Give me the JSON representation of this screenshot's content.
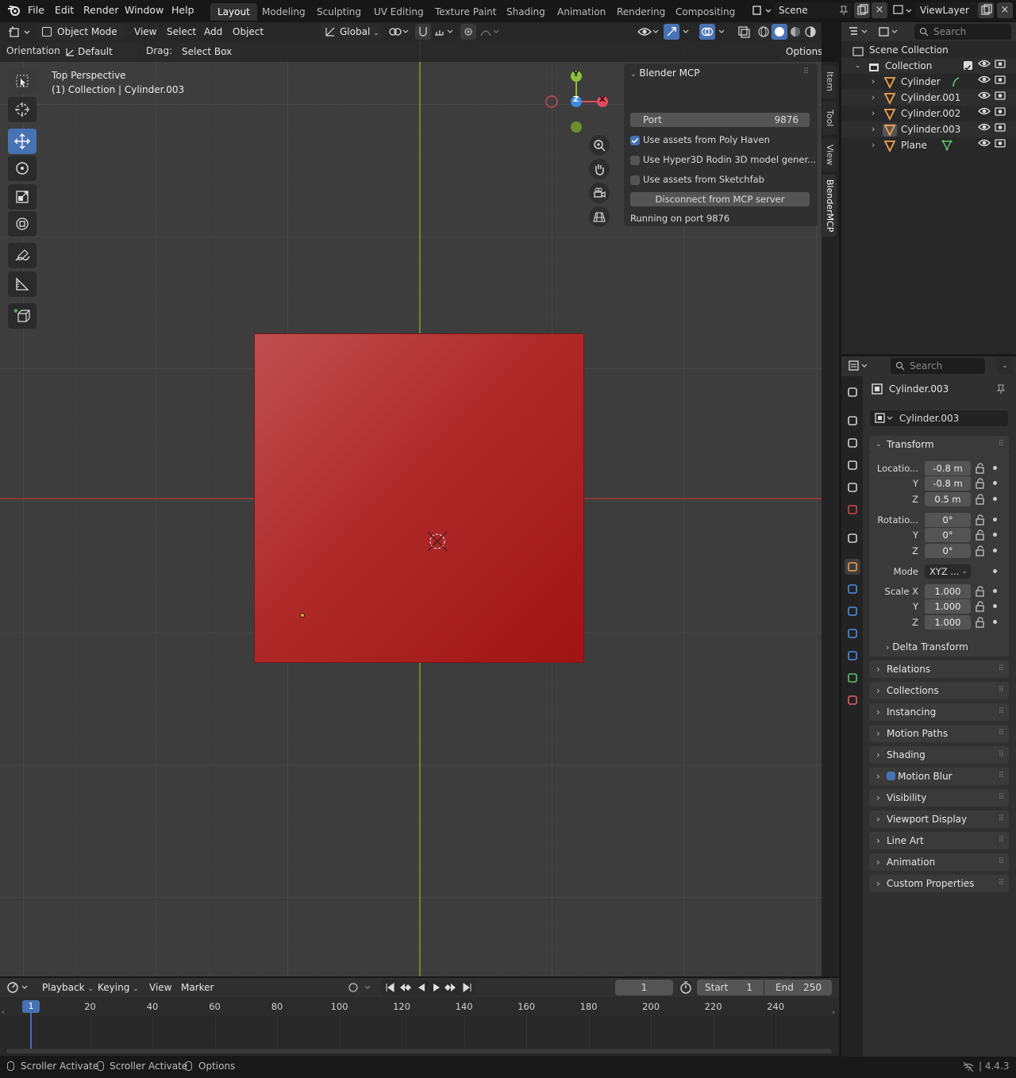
{
  "menu": {
    "items": [
      "File",
      "Edit",
      "Render",
      "Window",
      "Help"
    ]
  },
  "workspaces": [
    "Layout",
    "Modeling",
    "Sculpting",
    "UV Editing",
    "Texture Paint",
    "Shading",
    "Animation",
    "Rendering",
    "Compositing"
  ],
  "scene": {
    "name": "Scene",
    "view_layer": "ViewLayer"
  },
  "viewport_header": {
    "mode": "Object Mode",
    "menus": [
      "View",
      "Select",
      "Add",
      "Object"
    ],
    "transform_orientation": "Global"
  },
  "tool_header": {
    "orientation_label": "Orientation:",
    "orientation_value": "Default",
    "drag_label": "Drag:",
    "drag_value": "Select Box",
    "options": "Options"
  },
  "viewport": {
    "view_name": "Top Perspective",
    "context": "(1) Collection | Cylinder.003",
    "gizmo": {
      "x": "X",
      "y": "Y",
      "z": "Z"
    },
    "object_color": "#b22222"
  },
  "sidebar_tabs": [
    "Item",
    "Tool",
    "View",
    "BlenderMCP"
  ],
  "mcp_panel": {
    "title": "Blender MCP",
    "port_label": "Port",
    "port_value": "9876",
    "opt_polyhaven": "Use assets from Poly Haven",
    "opt_polyhaven_checked": true,
    "opt_hyper3d": "Use Hyper3D Rodin 3D model gener...",
    "opt_hyper3d_checked": false,
    "opt_sketchfab": "Use assets from Sketchfab",
    "opt_sketchfab_checked": false,
    "disconnect": "Disconnect from MCP server",
    "status": "Running on port 9876"
  },
  "outliner": {
    "search_placeholder": "Search",
    "scene_collection": "Scene Collection",
    "collection": "Collection",
    "items": [
      "Cylinder",
      "Cylinder.001",
      "Cylinder.002",
      "Cylinder.003",
      "Plane"
    ]
  },
  "properties": {
    "search_placeholder": "Search",
    "object_name": "Cylinder.003",
    "datablock": "Cylinder.003",
    "transform": {
      "title": "Transform",
      "location_label": "Locatio...",
      "loc_x": "-0.8 m",
      "loc_y": "-0.8 m",
      "loc_z": "0.5 m",
      "rotation_label": "Rotatio...",
      "rot_x": "0°",
      "rot_y": "0°",
      "rot_z": "0°",
      "mode_label": "Mode",
      "mode_value": "XYZ ...",
      "scale_label": "Scale X",
      "scale_x": "1.000",
      "scale_y": "1.000",
      "scale_z": "1.000",
      "y": "Y",
      "z": "Z",
      "delta": "Delta Transform"
    },
    "panels": [
      "Relations",
      "Collections",
      "Instancing",
      "Motion Paths",
      "Shading",
      "Motion Blur",
      "Visibility",
      "Viewport Display",
      "Line Art",
      "Animation",
      "Custom Properties"
    ]
  },
  "timeline": {
    "menus": [
      "Playback",
      "Keying",
      "View",
      "Marker"
    ],
    "current_frame": "1",
    "start_label": "Start",
    "start": "1",
    "end_label": "End",
    "end": "250",
    "ticks": [
      "1",
      "20",
      "40",
      "60",
      "80",
      "100",
      "120",
      "140",
      "160",
      "180",
      "200",
      "220",
      "240"
    ]
  },
  "status": {
    "items": [
      "Scroller Activate",
      "Scroller Activate",
      "Options"
    ],
    "version": "4.4.3"
  }
}
